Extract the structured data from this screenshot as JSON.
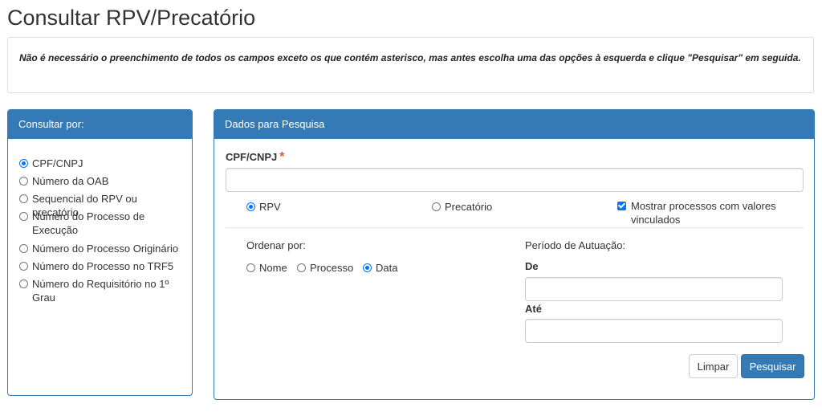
{
  "page": {
    "title": "Consultar RPV/Precatório",
    "notice": "Não é necessário o preenchimento de todos os campos exceto os que contém asterisco, mas antes escolha uma das opções à esquerda e clique \"Pesquisar\" em seguida."
  },
  "left_panel": {
    "heading": "Consultar por:",
    "options": [
      {
        "label": "CPF/CNPJ",
        "checked": true
      },
      {
        "label": "Número da OAB",
        "checked": false
      },
      {
        "label": "Sequencial do RPV ou precatório",
        "checked": false
      },
      {
        "label": "Número do Processo de Execução",
        "checked": false
      },
      {
        "label": "Número do Processo Originário",
        "checked": false
      },
      {
        "label": "Número do Processo no TRF5",
        "checked": false
      },
      {
        "label": "Número do Requisitório no 1º Grau",
        "checked": false
      }
    ]
  },
  "right_panel": {
    "heading": "Dados para Pesquisa",
    "cpf_label": "CPF/CNPJ",
    "required_mark": "*",
    "cpf_value": "",
    "type_options": [
      {
        "label": "RPV",
        "checked": true
      },
      {
        "label": "Precatório",
        "checked": false
      }
    ],
    "show_values_label": "Mostrar processos com valores vinculados",
    "show_values_checked": true,
    "order_label": "Ordenar por:",
    "order_options": [
      {
        "label": "Nome",
        "checked": false
      },
      {
        "label": "Processo",
        "checked": false
      },
      {
        "label": "Data",
        "checked": true
      }
    ],
    "period_label": "Período de Autuação:",
    "from_label": "De",
    "from_value": "",
    "to_label": "Até",
    "to_value": "",
    "clear_button": "Limpar",
    "search_button": "Pesquisar"
  },
  "colors": {
    "primary": "#337ab7",
    "radio_selected": "#0075ff",
    "required": "#e05a3a"
  }
}
